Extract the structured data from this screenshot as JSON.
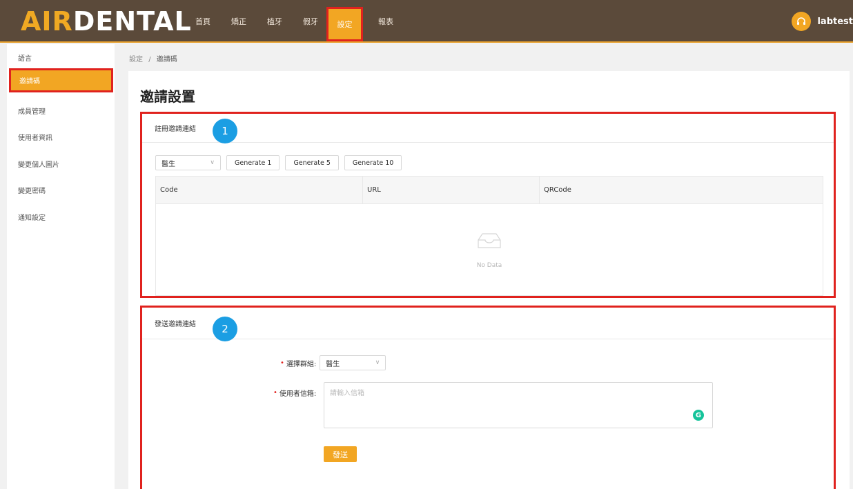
{
  "header": {
    "logo_ai": "AIR",
    "logo_dental": "DENTAL",
    "nav": [
      "首頁",
      "矯正",
      "植牙",
      "假牙",
      "設定",
      "報表"
    ],
    "active_nav": "設定",
    "user": "labtest"
  },
  "sidebar": {
    "items": [
      "語言",
      "邀請碼",
      "成員管理",
      "使用者資訊",
      "變更個人圖片",
      "變更密碼",
      "通知設定"
    ],
    "active": "邀請碼"
  },
  "breadcrumb": {
    "parent": "設定",
    "separator": "/",
    "current": "邀請碼"
  },
  "page": {
    "title": "邀請設置"
  },
  "section1": {
    "title": "註冊邀請連結",
    "badge": "1",
    "select_value": "醫生",
    "buttons": [
      "Generate 1",
      "Generate 5",
      "Generate 10"
    ],
    "columns": [
      "Code",
      "URL",
      "QRCode"
    ],
    "empty_text": "No Data"
  },
  "section2": {
    "title": "發送邀請連結",
    "badge": "2",
    "group_label": "選擇群組:",
    "group_value": "醫生",
    "email_label": "使用者信箱:",
    "email_placeholder": "請輸入信箱",
    "send_label": "發送"
  },
  "colors": {
    "header_bg": "#5b4a3a",
    "accent": "#f2a623",
    "highlight_border": "#e0221e",
    "badge": "#1b9ee3"
  }
}
